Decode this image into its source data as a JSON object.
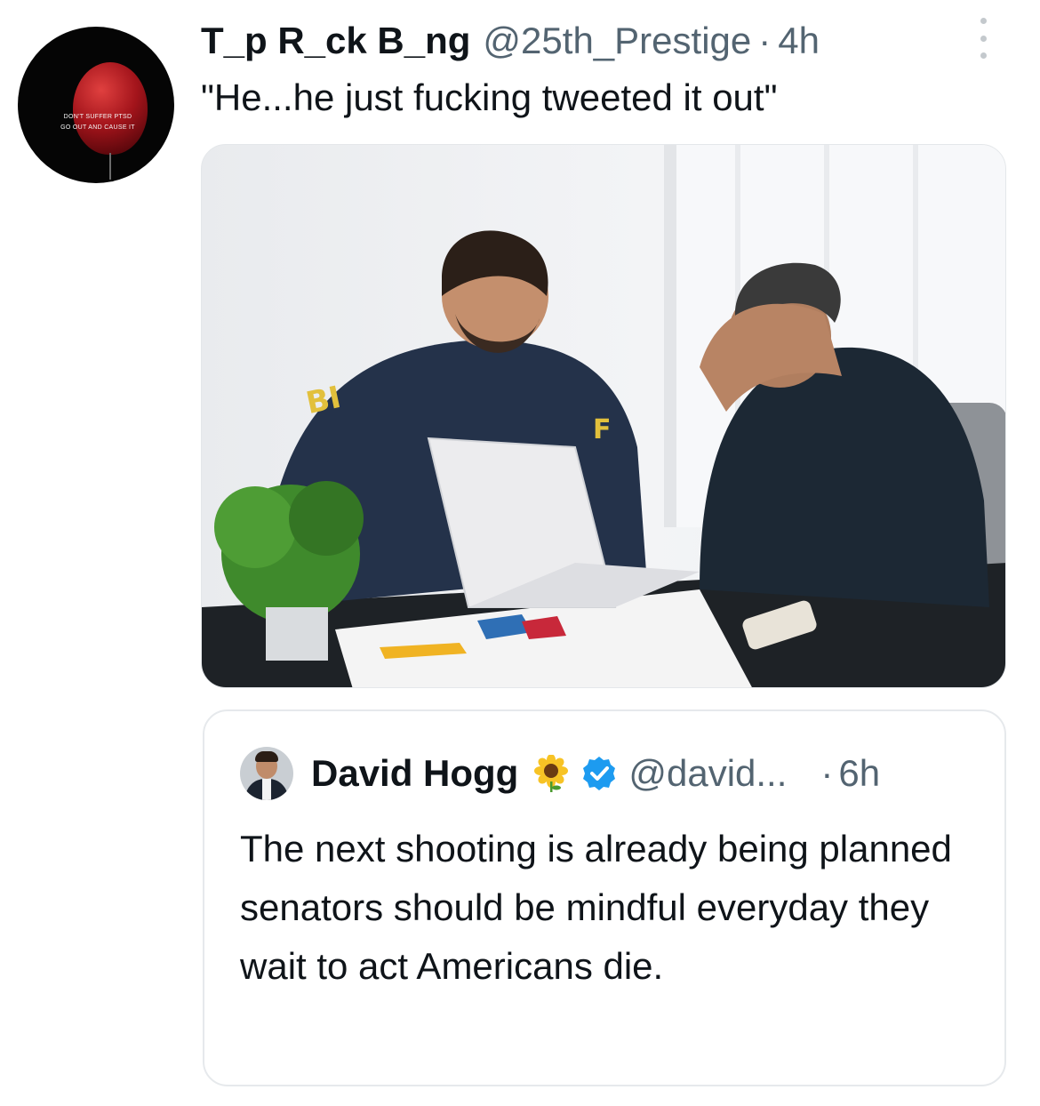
{
  "post": {
    "author_name": "T_p R_ck B_ng",
    "author_handle": "@25th_Prestige",
    "separator": "·",
    "time": "4h",
    "text": "\"He...he just fucking tweeted it out\"",
    "avatar_text": [
      "DON'T SUFFER PTSD",
      "GO OUT AND CAUSE IT"
    ],
    "icons": {
      "more": "more-vertical-icon"
    }
  },
  "media": {
    "jacket_text": [
      "BI",
      "F"
    ]
  },
  "quoted_tweet": {
    "author_name": "David Hogg",
    "author_handle": "@david...",
    "separator": "·",
    "time": "6h",
    "text": "The next shooting is already being planned senators should be mindful everyday they wait to act Americans die.",
    "icons": {
      "emoji": "sunflower-icon",
      "badge": "verified-icon"
    },
    "badge_color": "#1d9bf0"
  }
}
